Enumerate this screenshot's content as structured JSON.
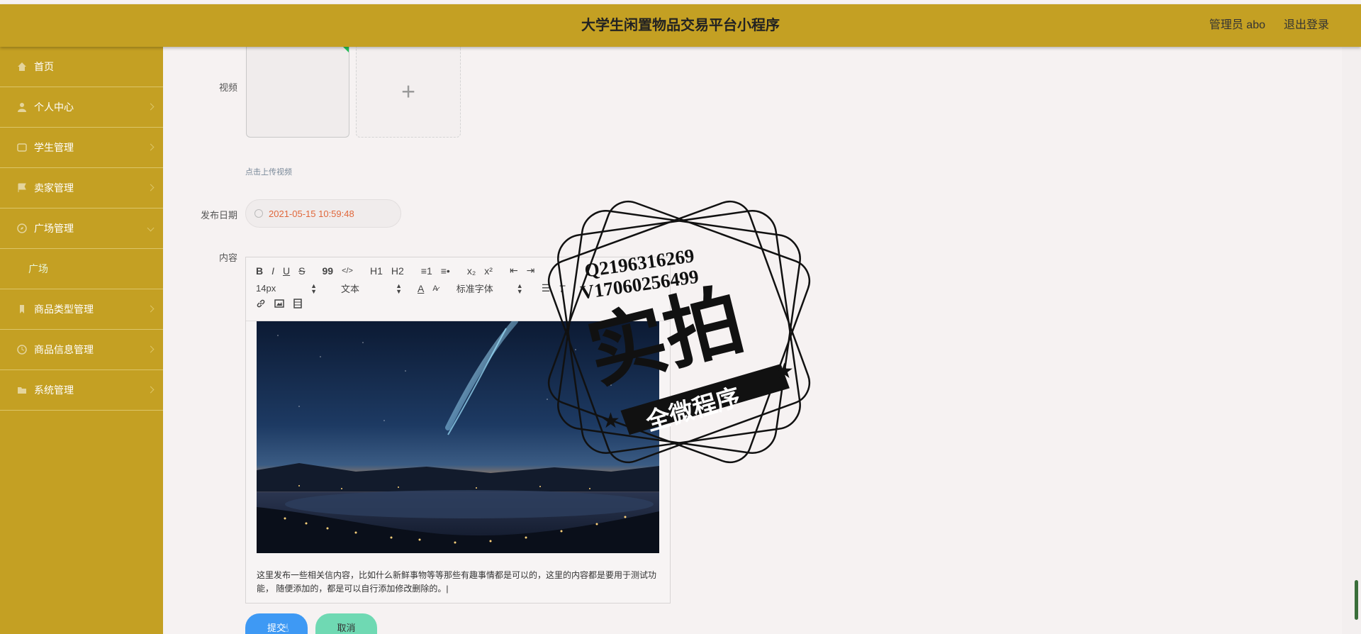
{
  "header": {
    "title": "大学生闲置物品交易平台小程序",
    "user": "管理员 abo",
    "logout": "退出登录"
  },
  "sidebar": {
    "items": [
      {
        "label": "首页",
        "icon": "home-icon"
      },
      {
        "label": "个人中心",
        "icon": "user-icon"
      },
      {
        "label": "学生管理",
        "icon": "student-icon"
      },
      {
        "label": "卖家管理",
        "icon": "flag-icon"
      },
      {
        "label": "广场管理",
        "icon": "compass-icon"
      },
      {
        "label": "广场",
        "icon": ""
      },
      {
        "label": "商品类型管理",
        "icon": "tag-icon"
      },
      {
        "label": "商品信息管理",
        "icon": "clock-icon"
      },
      {
        "label": "系统管理",
        "icon": "folder-icon"
      }
    ]
  },
  "form": {
    "video_label": "视频",
    "upload_tip": "点击上传视频",
    "date_label": "发布日期",
    "date_value": "2021-05-15 10:59:48",
    "content_label": "内容",
    "content_text": "这里发布一些相关信内容，比如什么新鲜事物等等那些有趣事情都是可以的，这里的内容都是要用于测试功能， 随便添加的，都是可以自行添加修改删除的。|",
    "submit": "提交",
    "cancel": "取消"
  },
  "editor": {
    "toolbar_row1": [
      "B",
      "I",
      "U",
      "S",
      "99",
      "</>",
      "H1",
      "H2",
      "≡1",
      "≡•",
      "x₂",
      "x²",
      "⇤",
      "⇥"
    ],
    "font_size": "14px",
    "text_type": "文本",
    "font_family": "标准字体",
    "toolbar_row3": [
      "link",
      "image",
      "video"
    ]
  },
  "watermark": {
    "line1": "Q2196316269",
    "line2": "V17060256499",
    "big": "实拍",
    "ribbon": "全微程序"
  },
  "colors": {
    "theme": "#c4a023",
    "submit": "#3e99f4",
    "cancel": "#6fd9b3",
    "date": "#e0683c"
  }
}
